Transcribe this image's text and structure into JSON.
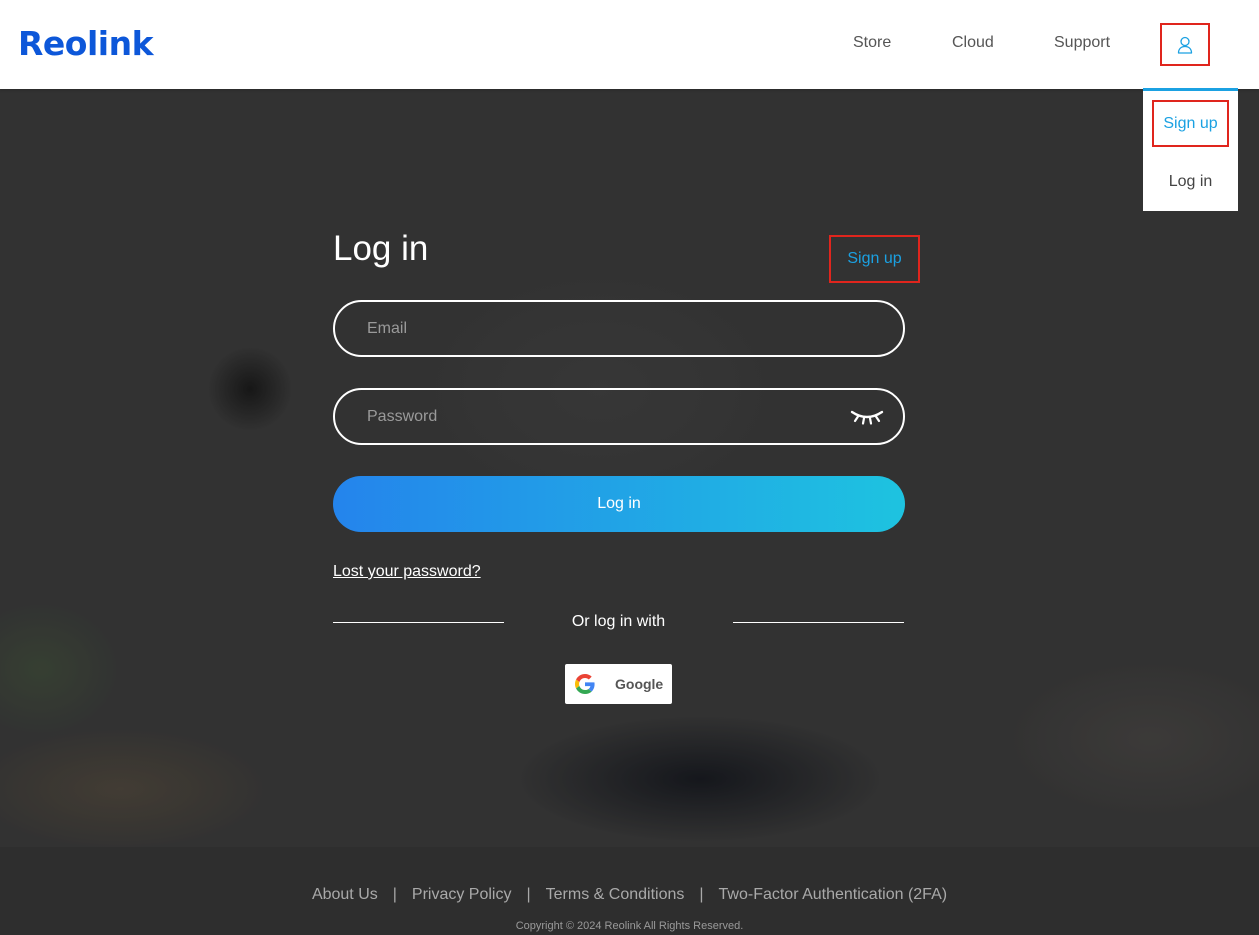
{
  "header": {
    "logo": "Reolink",
    "nav": [
      {
        "label": "Store"
      },
      {
        "label": "Cloud"
      },
      {
        "label": "Support"
      }
    ],
    "user_icon": "user-icon"
  },
  "dropdown": {
    "signup_label": "Sign up",
    "login_label": "Log in"
  },
  "form": {
    "title": "Log in",
    "signup_label": "Sign up",
    "email_placeholder": "Email",
    "email_value": "",
    "password_placeholder": "Password",
    "password_value": "",
    "eye_icon": "eye-closed-icon",
    "login_button": "Log in",
    "lost_password": "Lost your password?",
    "or_text": "Or log in with",
    "google_label": "Google"
  },
  "footer": {
    "links": [
      {
        "label": "About Us"
      },
      {
        "label": "Privacy Policy"
      },
      {
        "label": "Terms & Conditions"
      },
      {
        "label": "Two-Factor Authentication (2FA)"
      }
    ],
    "separator": "|",
    "copyright": "Copyright © 2024 Reolink All Rights Reserved."
  },
  "colors": {
    "brand_blue": "#0d57d9",
    "accent_cyan": "#1ba1e2",
    "highlight_red": "#e0251d",
    "button_gradient_start": "#2484ec",
    "button_gradient_end": "#1ec3e0"
  }
}
